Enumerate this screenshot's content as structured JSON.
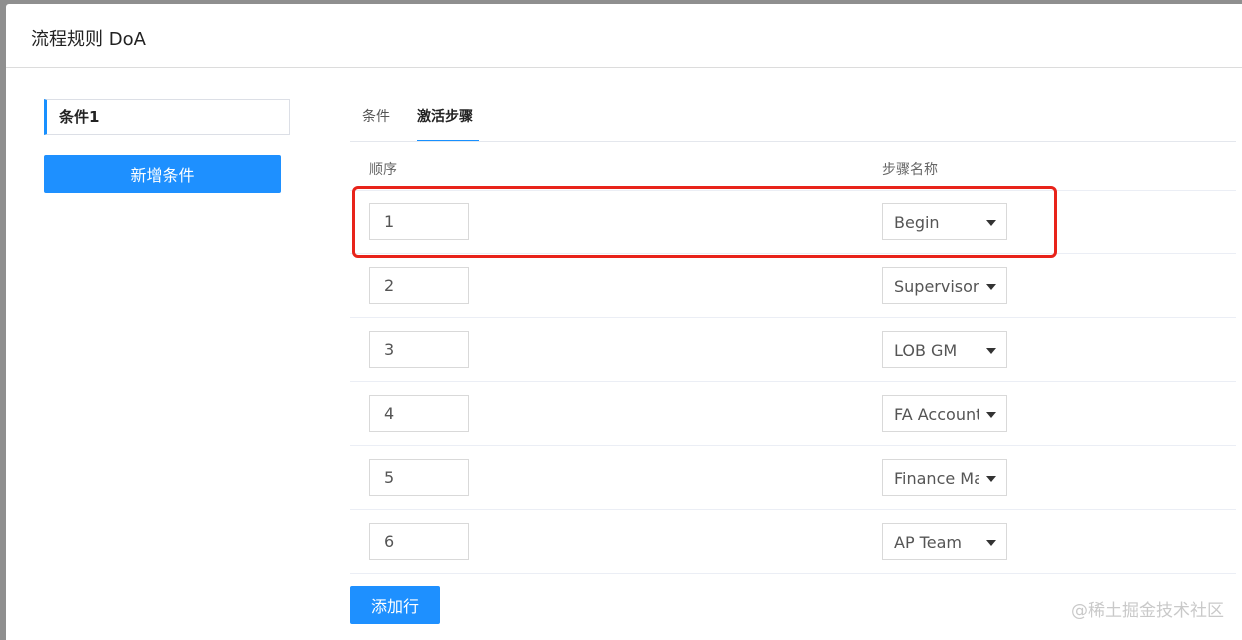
{
  "dialog": {
    "title": "流程规则 DoA"
  },
  "conditions": {
    "items": [
      {
        "label": "条件1"
      }
    ],
    "add_button_label": "新增条件"
  },
  "tabs": [
    {
      "label": "条件",
      "active": false
    },
    {
      "label": "激活步骤",
      "active": true
    }
  ],
  "table": {
    "headers": {
      "order": "顺序",
      "step_name": "步骤名称"
    },
    "rows": [
      {
        "order": "1",
        "step": "Begin",
        "highlighted": true
      },
      {
        "order": "2",
        "step": "Supervisor",
        "highlighted": false
      },
      {
        "order": "3",
        "step": "LOB GM",
        "highlighted": false
      },
      {
        "order": "4",
        "step": "FA Account",
        "highlighted": false
      },
      {
        "order": "5",
        "step": "Finance Ma",
        "highlighted": false
      },
      {
        "order": "6",
        "step": "AP Team",
        "highlighted": false
      }
    ]
  },
  "add_row_button_label": "添加行",
  "watermark": "@稀土掘金技术社区",
  "colors": {
    "primary": "#1e90ff",
    "highlight_border": "#e8231a",
    "active_tab_underline": "#1890ff"
  }
}
